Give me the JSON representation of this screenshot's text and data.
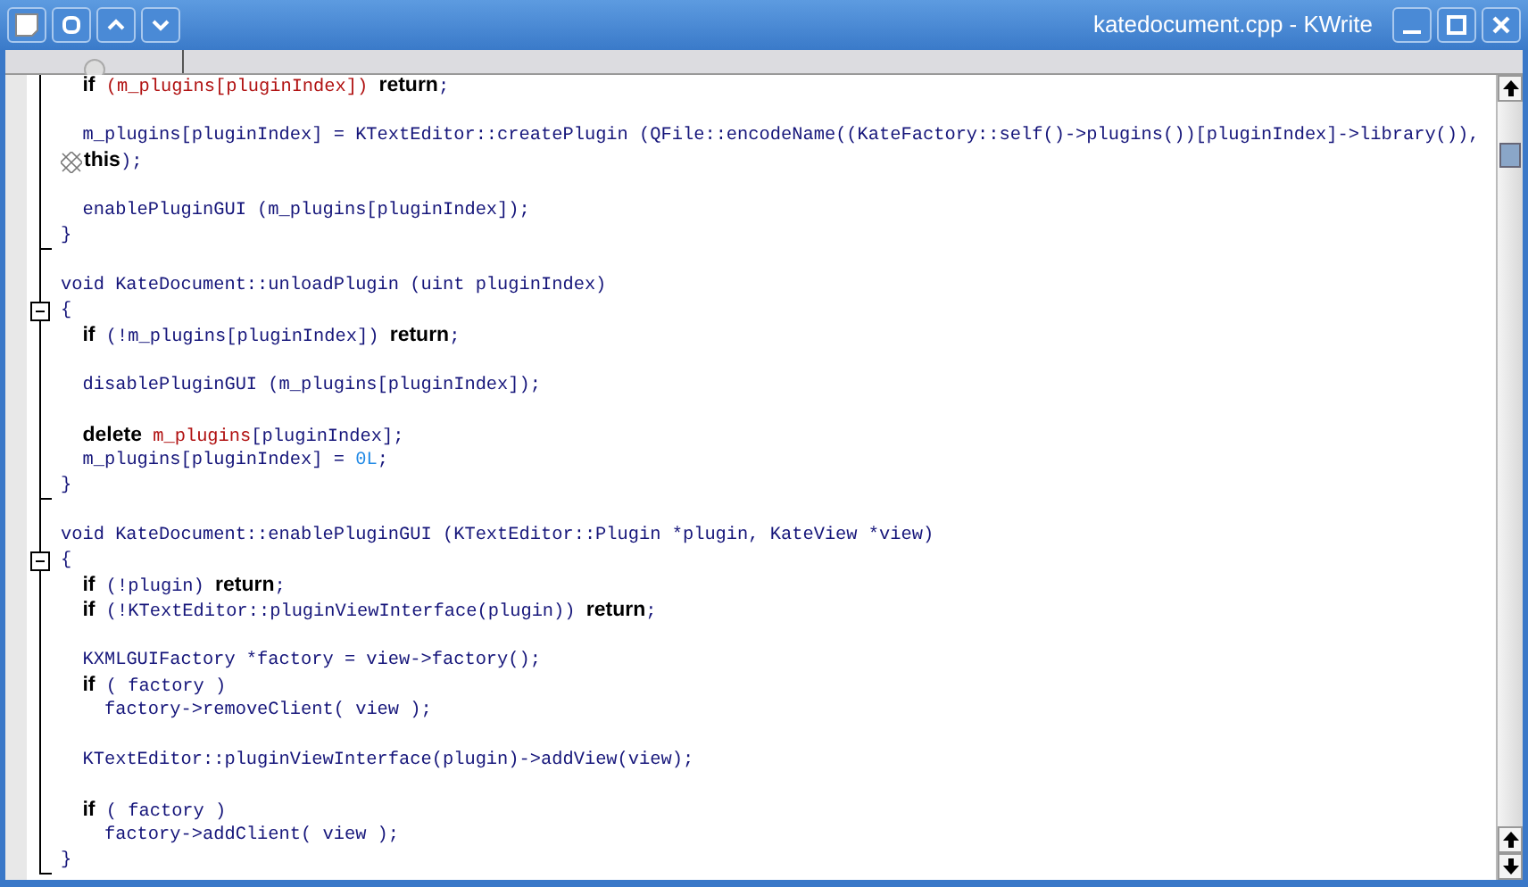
{
  "window": {
    "title": "katedocument.cpp - KWrite"
  },
  "editor": {
    "lines": [
      {
        "tokens": [
          {
            "kind": "kw",
            "text": "  if"
          },
          {
            "kind": "member",
            "text": " (m_plugins[pluginIndex]) "
          },
          {
            "kind": "kw",
            "text": "return"
          },
          {
            "kind": "plain",
            "text": ";"
          }
        ]
      },
      {
        "blank_before": true,
        "tokens": [
          {
            "kind": "plain",
            "text": "  m_plugins[pluginIndex] = KTextEditor::createPlugin (QFile::encodeName((KateFactory::self()->plugins())[pluginIndex]->library()),"
          }
        ]
      },
      {
        "wrapped": true,
        "tokens": [
          {
            "kind": "kw",
            "text": "this"
          },
          {
            "kind": "plain",
            "text": ");"
          }
        ]
      },
      {
        "blank_before": true,
        "tokens": [
          {
            "kind": "plain",
            "text": "  enablePluginGUI (m_plugins[pluginIndex]);"
          }
        ]
      },
      {
        "fold_end": true,
        "tokens": [
          {
            "kind": "plain",
            "text": "}"
          }
        ]
      },
      {
        "blank_before": true,
        "tokens": [
          {
            "kind": "plain",
            "text": "void KateDocument::unloadPlugin (uint pluginIndex)"
          }
        ]
      },
      {
        "fold_start": true,
        "tokens": [
          {
            "kind": "plain",
            "text": "{"
          }
        ]
      },
      {
        "tokens": [
          {
            "kind": "kw",
            "text": "  if"
          },
          {
            "kind": "plain",
            "text": " (!m_plugins[pluginIndex]) "
          },
          {
            "kind": "kw",
            "text": "return"
          },
          {
            "kind": "plain",
            "text": ";"
          }
        ]
      },
      {
        "blank_before": true,
        "tokens": [
          {
            "kind": "plain",
            "text": "  disablePluginGUI (m_plugins[pluginIndex]);"
          }
        ]
      },
      {
        "blank_before": true,
        "tokens": [
          {
            "kind": "kw",
            "text": "  delete"
          },
          {
            "kind": "member",
            "text": " m_plugins"
          },
          {
            "kind": "plain",
            "text": "[pluginIndex];"
          }
        ]
      },
      {
        "tokens": [
          {
            "kind": "plain",
            "text": "  m_plugins[pluginIndex] = "
          },
          {
            "kind": "num",
            "text": "0L"
          },
          {
            "kind": "plain",
            "text": ";"
          }
        ]
      },
      {
        "fold_end": true,
        "tokens": [
          {
            "kind": "plain",
            "text": "}"
          }
        ]
      },
      {
        "blank_before": true,
        "tokens": [
          {
            "kind": "plain",
            "text": "void KateDocument::enablePluginGUI (KTextEditor::Plugin *plugin, KateView *view)"
          }
        ]
      },
      {
        "fold_start": true,
        "tokens": [
          {
            "kind": "plain",
            "text": "{"
          }
        ]
      },
      {
        "tokens": [
          {
            "kind": "kw",
            "text": "  if"
          },
          {
            "kind": "plain",
            "text": " (!plugin) "
          },
          {
            "kind": "kw",
            "text": "return"
          },
          {
            "kind": "plain",
            "text": ";"
          }
        ]
      },
      {
        "tokens": [
          {
            "kind": "kw",
            "text": "  if"
          },
          {
            "kind": "plain",
            "text": " (!KTextEditor::pluginViewInterface(plugin)) "
          },
          {
            "kind": "kw",
            "text": "return"
          },
          {
            "kind": "plain",
            "text": ";"
          }
        ]
      },
      {
        "blank_before": true,
        "tokens": [
          {
            "kind": "plain",
            "text": "  KXMLGUIFactory *factory = view->factory();"
          }
        ]
      },
      {
        "tokens": [
          {
            "kind": "kw",
            "text": "  if"
          },
          {
            "kind": "plain",
            "text": " ( factory )"
          }
        ]
      },
      {
        "tokens": [
          {
            "kind": "plain",
            "text": "    factory->removeClient( view );"
          }
        ]
      },
      {
        "blank_before": true,
        "tokens": [
          {
            "kind": "plain",
            "text": "  KTextEditor::pluginViewInterface(plugin)->addView(view);"
          }
        ]
      },
      {
        "blank_before": true,
        "tokens": [
          {
            "kind": "kw",
            "text": "  if"
          },
          {
            "kind": "plain",
            "text": " ( factory )"
          }
        ]
      },
      {
        "tokens": [
          {
            "kind": "plain",
            "text": "    factory->addClient( view );"
          }
        ]
      },
      {
        "fold_end": true,
        "tokens": [
          {
            "kind": "plain",
            "text": "}"
          }
        ]
      }
    ]
  }
}
